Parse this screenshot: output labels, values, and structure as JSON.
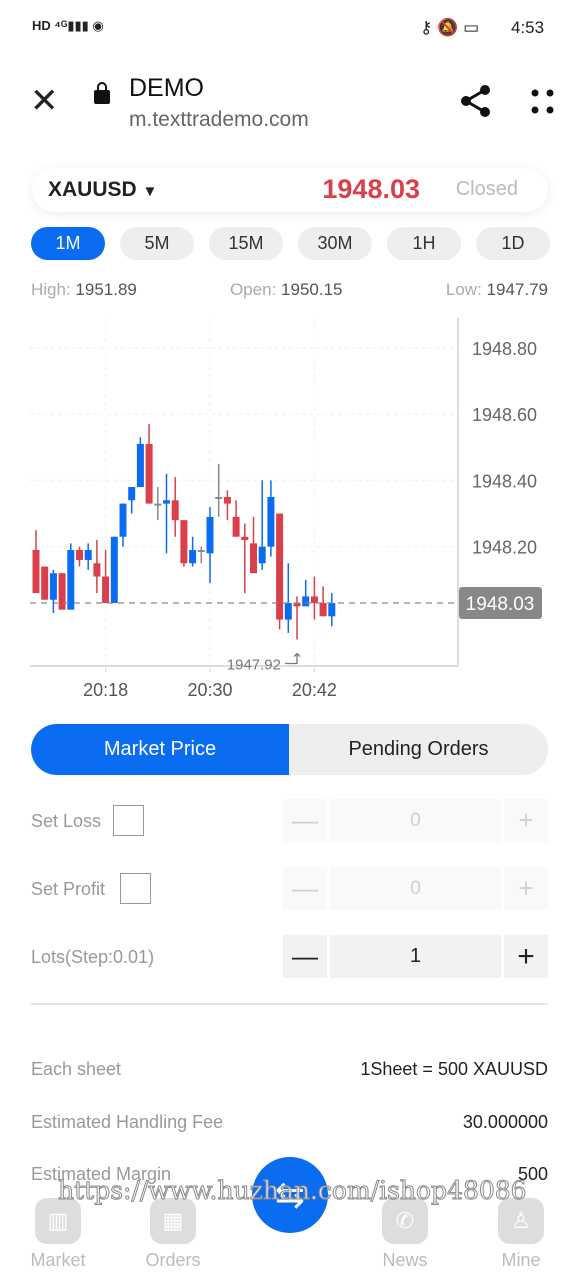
{
  "status_bar": {
    "time": "4:53",
    "left_icons": [
      "hd-icon",
      "4g-signal-icon",
      "hotspot-icon"
    ],
    "right_icons": [
      "key-icon",
      "mute-bell-icon",
      "battery-icon"
    ]
  },
  "browser": {
    "title": "DEMO",
    "url": "m.texttrademo.com"
  },
  "ticker": {
    "symbol": "XAUUSD",
    "price": "1948.03",
    "state": "Closed",
    "price_color": "#d9404b"
  },
  "timeframes": [
    {
      "label": "1M",
      "active": true
    },
    {
      "label": "5M"
    },
    {
      "label": "15M"
    },
    {
      "label": "30M"
    },
    {
      "label": "1H"
    },
    {
      "label": "1D"
    }
  ],
  "stats": {
    "high_label": "High:",
    "high": "1951.89",
    "open_label": "Open:",
    "open": "1950.15",
    "low_label": "Low:",
    "low": "1947.79"
  },
  "chart_data": {
    "type": "candlestick",
    "y_ticks": [
      "1948.80",
      "1948.60",
      "1948.40",
      "1948.20"
    ],
    "x_ticks": [
      "20:18",
      "20:30",
      "20:42"
    ],
    "ylim": [
      1947.84,
      1948.89
    ],
    "current_price": "1948.03",
    "min_label": "1947.92",
    "up_color": "#0a6cf0",
    "down_color": "#d9404b",
    "grid": true,
    "start_time": "20:10",
    "candles": [
      [
        1948.19,
        1948.25,
        1948.06,
        1948.06
      ],
      [
        1948.14,
        1948.14,
        1948.04,
        1948.04
      ],
      [
        1948.04,
        1948.13,
        1948.0,
        1948.12
      ],
      [
        1948.12,
        1948.12,
        1948.01,
        1948.01
      ],
      [
        1948.01,
        1948.21,
        1948.01,
        1948.19
      ],
      [
        1948.19,
        1948.2,
        1948.14,
        1948.16
      ],
      [
        1948.16,
        1948.21,
        1948.13,
        1948.19
      ],
      [
        1948.15,
        1948.22,
        1948.06,
        1948.11
      ],
      [
        1948.11,
        1948.19,
        1948.03,
        1948.03
      ],
      [
        1948.03,
        1948.23,
        1948.03,
        1948.23
      ],
      [
        1948.23,
        1948.33,
        1948.2,
        1948.33
      ],
      [
        1948.34,
        1948.38,
        1948.3,
        1948.38
      ],
      [
        1948.38,
        1948.53,
        1948.38,
        1948.51
      ],
      [
        1948.51,
        1948.57,
        1948.33,
        1948.33
      ],
      [
        1948.33,
        1948.38,
        1948.28,
        1948.33
      ],
      [
        1948.33,
        1948.42,
        1948.18,
        1948.34
      ],
      [
        1948.34,
        1948.41,
        1948.23,
        1948.28
      ],
      [
        1948.28,
        1948.28,
        1948.14,
        1948.15
      ],
      [
        1948.15,
        1948.23,
        1948.14,
        1948.19
      ],
      [
        1948.19,
        1948.2,
        1948.15,
        1948.19
      ],
      [
        1948.18,
        1948.32,
        1948.09,
        1948.29
      ],
      [
        1948.35,
        1948.45,
        1948.29,
        1948.35
      ],
      [
        1948.35,
        1948.37,
        1948.28,
        1948.33
      ],
      [
        1948.29,
        1948.34,
        1948.23,
        1948.23
      ],
      [
        1948.23,
        1948.27,
        1948.06,
        1948.22
      ],
      [
        1948.21,
        1948.29,
        1948.12,
        1948.12
      ],
      [
        1948.15,
        1948.4,
        1948.13,
        1948.2
      ],
      [
        1948.2,
        1948.4,
        1948.17,
        1948.35
      ],
      [
        1948.3,
        1948.3,
        1947.95,
        1947.98
      ],
      [
        1947.98,
        1948.15,
        1947.94,
        1948.03
      ],
      [
        1948.03,
        1948.05,
        1947.92,
        1948.02
      ],
      [
        1948.02,
        1948.1,
        1948.02,
        1948.05
      ],
      [
        1948.05,
        1948.11,
        1947.98,
        1948.03
      ],
      [
        1948.03,
        1948.08,
        1947.99,
        1947.99
      ],
      [
        1947.99,
        1948.06,
        1947.96,
        1948.03
      ]
    ]
  },
  "order_tabs": {
    "market": "Market Price",
    "pending": "Pending Orders"
  },
  "form": {
    "set_loss": "Set Loss",
    "set_loss_value": "0",
    "set_profit": "Set Profit",
    "set_profit_value": "0",
    "lots": "Lots(Step:0.01)",
    "lots_value": "1",
    "minus": "—",
    "plus": "+"
  },
  "info": [
    {
      "label": "Each sheet",
      "value": "1Sheet = 500 XAUUSD"
    },
    {
      "label": "Estimated Handling Fee",
      "value": "30.000000"
    },
    {
      "label": "Estimated Margin",
      "value": "500"
    }
  ],
  "nav": {
    "market": "Market",
    "orders": "Orders",
    "news": "News",
    "mine": "Mine"
  },
  "watermark": "https://www.huzhan.com/ishop48086"
}
